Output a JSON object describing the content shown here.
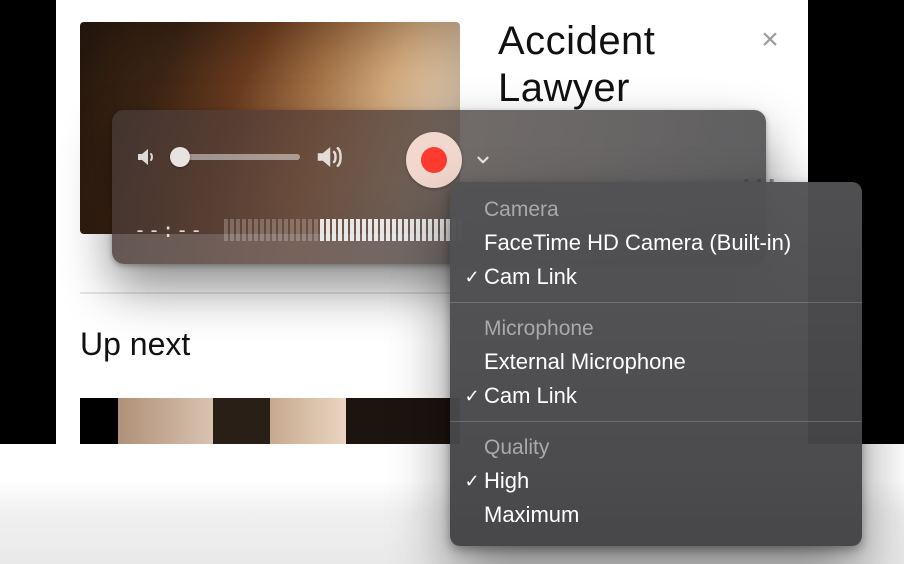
{
  "background": {
    "ad_title": "Accident Lawyer",
    "close_glyph": "×",
    "ad_menu_glyph": "⋯",
    "up_next_label": "Up next"
  },
  "hud": {
    "time_display": "--:--",
    "meter_bars_total": 40,
    "meter_bars_on_from": 16
  },
  "menu": {
    "sections": [
      {
        "label": "Camera",
        "items": [
          {
            "label": "FaceTime HD Camera (Built-in)",
            "checked": false
          },
          {
            "label": "Cam Link",
            "checked": true
          }
        ]
      },
      {
        "label": "Microphone",
        "items": [
          {
            "label": "External Microphone",
            "checked": false
          },
          {
            "label": "Cam Link",
            "checked": true
          }
        ]
      },
      {
        "label": "Quality",
        "items": [
          {
            "label": "High",
            "checked": true
          },
          {
            "label": "Maximum",
            "checked": false
          }
        ]
      }
    ]
  }
}
